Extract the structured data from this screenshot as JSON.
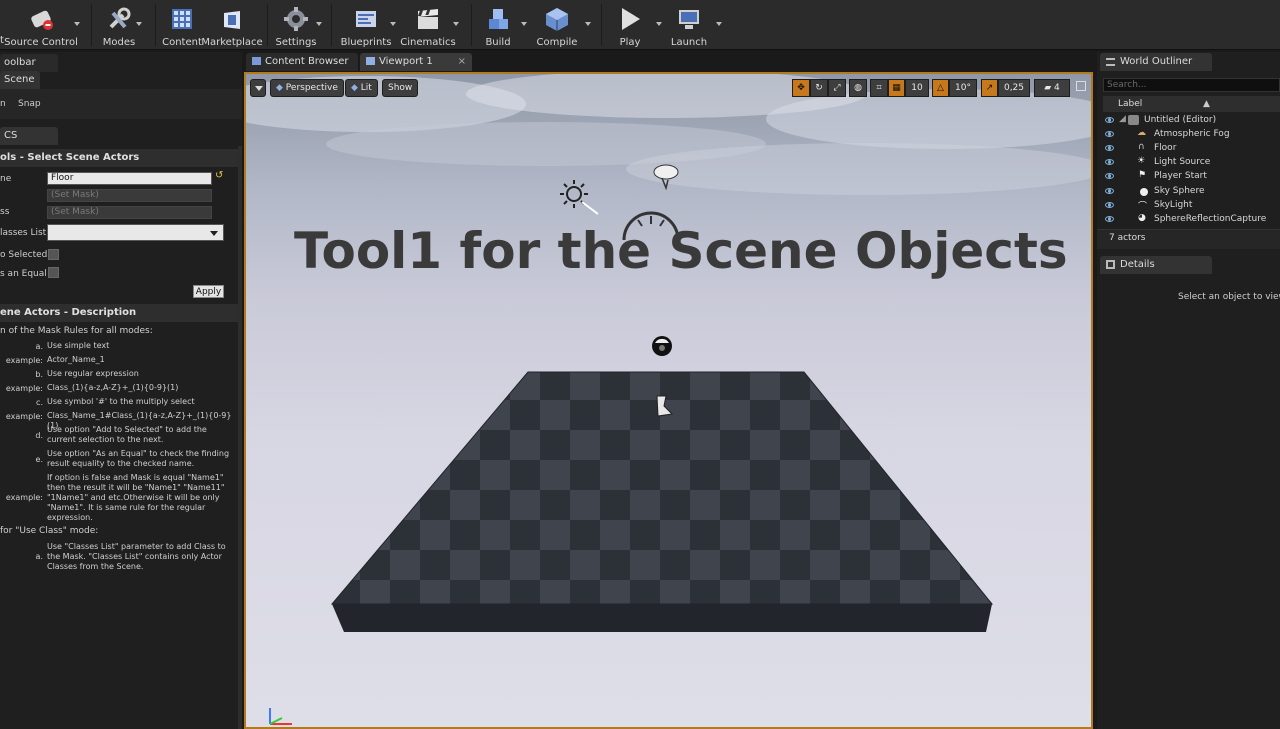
{
  "toolbar": {
    "items": [
      {
        "label": "Source Control",
        "icon": "source-control-icon"
      },
      {
        "label": "Modes",
        "icon": "modes-icon"
      },
      {
        "label": "Content",
        "icon": "content-icon"
      },
      {
        "label": "Marketplace",
        "icon": "marketplace-icon"
      },
      {
        "label": "Settings",
        "icon": "settings-icon"
      },
      {
        "label": "Blueprints",
        "icon": "blueprints-icon"
      },
      {
        "label": "Cinematics",
        "icon": "cinematics-icon"
      },
      {
        "label": "Build",
        "icon": "build-icon"
      },
      {
        "label": "Compile",
        "icon": "compile-icon"
      },
      {
        "label": "Play",
        "icon": "play-icon"
      },
      {
        "label": "Launch",
        "icon": "launch-icon"
      }
    ],
    "partial_left": "t"
  },
  "left_panel": {
    "tab_toolbar": "oolbar",
    "tab_scene": "Scene",
    "menu_left": "n",
    "menu_snap": "Snap",
    "tab_cs": "CS",
    "tools_header": "ols - Select Scene Actors",
    "fields": {
      "name_label": "ne",
      "name_value": "Floor",
      "mask_placeholder": "(Set Mask)",
      "class_label": "ss",
      "class_placeholder": "(Set Mask)",
      "classes_list_label": "lasses List:",
      "add_selected_label": "o Selected",
      "as_equal_label": "s an Equal",
      "apply_label": "Apply"
    },
    "desc_header": "ene Actors - Description",
    "desc_intro": "n of the Mask Rules for all modes:",
    "desc_rows": [
      {
        "key": "a.",
        "text": "Use simple text"
      },
      {
        "key": "example:",
        "text": "Actor_Name_1"
      },
      {
        "key": "b.",
        "text": "Use regular expression"
      },
      {
        "key": "example:",
        "text": "Class_(1){a-z,A-Z}+_(1){0-9}(1)"
      },
      {
        "key": "c.",
        "text": "Use symbol '#' to the multiply select"
      },
      {
        "key": "example:",
        "text": "Class_Name_1#Class_(1){a-z,A-Z}+_(1){0-9}(1)"
      },
      {
        "key": "d.",
        "text": "Use option \"Add to Selected\" to add the current selection to the next."
      },
      {
        "key": "e.",
        "text": "Use option \"As an Equal\" to check the finding result equality to the checked name."
      },
      {
        "key": "example:",
        "text": "If option is false and Mask is equal \"Name1\" then the result it will be \"Name1\" \"Name11\" \"1Name1\" and etc.Otherwise it will be only \"Name1\". It is same rule for the regular expression."
      }
    ],
    "use_class_title": "for \"Use Class\" mode:",
    "use_class_rows": [
      {
        "key": "a.",
        "text": "Use \"Classes List\" parameter to add Class to the Mask. \"Classes List\" contains only Actor Classes from the Scene."
      }
    ]
  },
  "viewport": {
    "tabs": [
      {
        "label": "Content Browser",
        "icon": "content-browser-icon"
      },
      {
        "label": "Viewport 1",
        "icon": "viewport-icon"
      }
    ],
    "perspective_label": "Perspective",
    "lit_label": "Lit",
    "show_label": "Show",
    "grid_snap": "10",
    "rotation_snap": "10°",
    "scale_snap": "0,25",
    "camera_speed": "4",
    "headline": "Tool1 for the Scene Objects"
  },
  "world_outliner": {
    "tab_label": "World Outliner",
    "search_placeholder": "Search...",
    "column_label": "Label",
    "items": [
      {
        "label": "Untitled (Editor)",
        "icon": "world-icon"
      },
      {
        "label": "Atmospheric Fog",
        "icon": "fog-icon"
      },
      {
        "label": "Floor",
        "icon": "static-mesh-icon"
      },
      {
        "label": "Light Source",
        "icon": "light-icon"
      },
      {
        "label": "Player Start",
        "icon": "player-start-icon"
      },
      {
        "label": "Sky Sphere",
        "icon": "sphere-icon"
      },
      {
        "label": "SkyLight",
        "icon": "skylight-icon"
      },
      {
        "label": "SphereReflectionCapture",
        "icon": "reflection-capture-icon"
      }
    ],
    "actor_count": "7 actors"
  },
  "details": {
    "tab_label": "Details",
    "empty_text": "Select an object to view d"
  },
  "colors": {
    "accent": "#c6781a",
    "panel": "#1f1f1f",
    "toolbar": "#2b2b2b"
  }
}
